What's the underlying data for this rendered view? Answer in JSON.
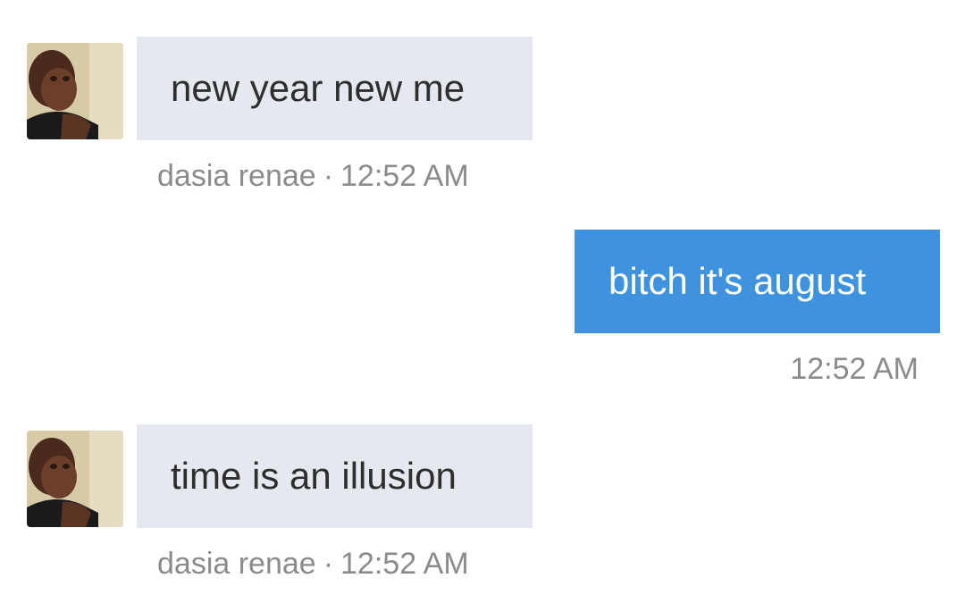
{
  "messages": [
    {
      "direction": "incoming",
      "text": "new year new me",
      "sender": "dasia renae",
      "separator": "·",
      "time": "12:52 AM"
    },
    {
      "direction": "outgoing",
      "text": "bitch it's august",
      "time": "12:52 AM"
    },
    {
      "direction": "incoming",
      "text": "time is an illusion",
      "sender": "dasia renae",
      "separator": "·",
      "time": "12:52 AM"
    }
  ],
  "colors": {
    "incoming_bubble": "#e5e8ef",
    "outgoing_bubble": "#3f93de",
    "meta_text": "#8b8b8b"
  }
}
